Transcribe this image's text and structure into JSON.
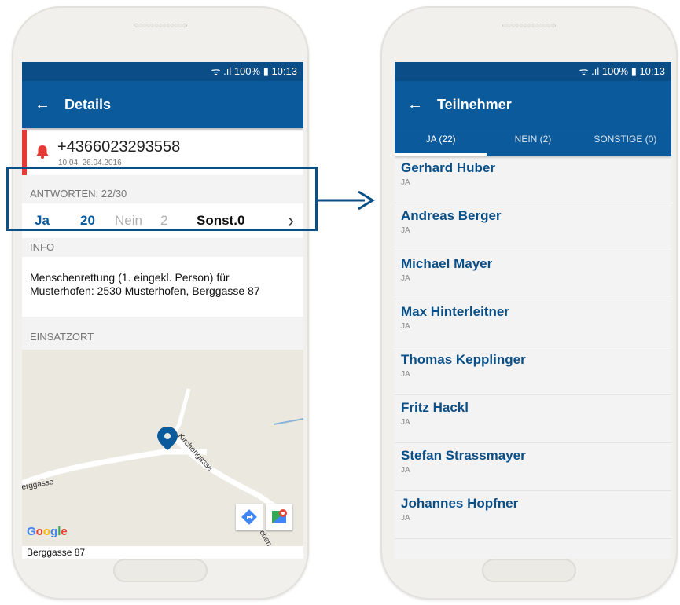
{
  "status_bar": {
    "text": "ᯤ .ıl 100% ▮ 10:13"
  },
  "details": {
    "title": "Details",
    "alarm": {
      "phone": "+4366023293558",
      "time": "10:04, 26.04.2016"
    },
    "answers": {
      "header": "ANTWORTEN: 22/30",
      "ja_label": "Ja",
      "ja_count": "20",
      "nein_label": "Nein",
      "nein_count": "2",
      "sonst_label": "Sonst.0"
    },
    "info": {
      "header": "INFO",
      "text": "Menschenrettung (1. eingekl. Person) für Musterhofen: 2530 Musterhofen, Berggasse 87"
    },
    "location": {
      "header": "EINSATZORT",
      "map_labels": {
        "street_1": "Kirchengasse",
        "street_2": "erggasse",
        "street_3": "chen"
      },
      "google": {
        "g1": "G",
        "o1": "o",
        "o2": "o",
        "g2": "g",
        "l": "l",
        "e": "e"
      },
      "address": "Berggasse 87"
    }
  },
  "participants": {
    "title": "Teilnehmer",
    "tabs": [
      {
        "label": "JA (22)"
      },
      {
        "label": "NEIN (2)"
      },
      {
        "label": "SONSTIGE (0)"
      }
    ],
    "people": [
      {
        "name": "Gerhard Huber",
        "status": "JA"
      },
      {
        "name": "Andreas Berger",
        "status": "JA"
      },
      {
        "name": "Michael Mayer",
        "status": "JA"
      },
      {
        "name": "Max Hinterleitner",
        "status": "JA"
      },
      {
        "name": "Thomas Kepplinger",
        "status": "JA"
      },
      {
        "name": "Fritz Hackl",
        "status": "JA"
      },
      {
        "name": "Stefan Strassmayer",
        "status": "JA"
      },
      {
        "name": "Johannes Hopfner",
        "status": "JA"
      }
    ]
  },
  "colors": {
    "primary": "#0b5a9c",
    "statusbar": "#0a4d87",
    "alarm": "#e53935",
    "highlight": "#0b4f87"
  }
}
